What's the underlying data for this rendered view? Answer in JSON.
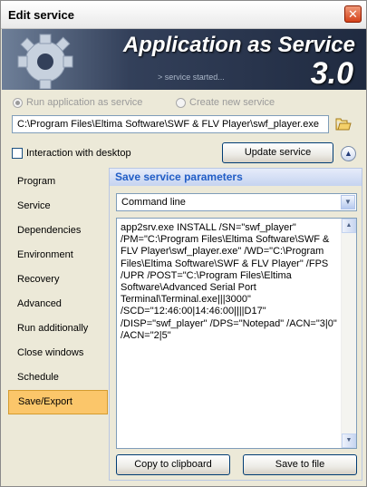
{
  "window": {
    "title": "Edit service",
    "close_glyph": "✕"
  },
  "banner": {
    "title": "Application as Service",
    "subtitle": "> service started...",
    "version": "3.0"
  },
  "mode": {
    "run_app_label": "Run application as service",
    "create_new_label": "Create new service",
    "selected": "run_app"
  },
  "path": {
    "value": "C:\\Program Files\\Eltima Software\\SWF & FLV Player\\swf_player.exe"
  },
  "interaction": {
    "label": "Interaction with desktop",
    "checked": false
  },
  "update_button": "Update service",
  "nav": {
    "items": [
      {
        "label": "Program"
      },
      {
        "label": "Service"
      },
      {
        "label": "Dependencies"
      },
      {
        "label": "Environment"
      },
      {
        "label": "Recovery"
      },
      {
        "label": "Advanced"
      },
      {
        "label": "Run additionally"
      },
      {
        "label": "Close windows"
      },
      {
        "label": "Schedule"
      },
      {
        "label": "Save/Export"
      }
    ],
    "active": "Save/Export"
  },
  "save_panel": {
    "header": "Save service parameters",
    "format_selected": "Command line",
    "command_text": "app2srv.exe INSTALL /SN=\"swf_player\" /PM=\"C:\\Program Files\\Eltima Software\\SWF & FLV Player\\swf_player.exe\" /WD=\"C:\\Program Files\\Eltima Software\\SWF & FLV Player\" /FPS /UPR /POST=\"C:\\Program Files\\Eltima Software\\Advanced Serial Port Terminal\\Terminal.exe|||3000\" /SCD=\"12:46:00|14:46:00||||D17\" /DISP=\"swf_player\" /DPS=\"Notepad\" /ACN=\"3|0\" /ACN=\"2|5\"",
    "copy_button": "Copy to clipboard",
    "save_button": "Save to file"
  },
  "colors": {
    "accent": "#215dc6",
    "active_nav": "#fbc66a"
  },
  "icons": {
    "close": "close-icon",
    "gear": "gear-icon",
    "folder": "folder-open-icon",
    "collapse": "chevron-up-icon"
  }
}
